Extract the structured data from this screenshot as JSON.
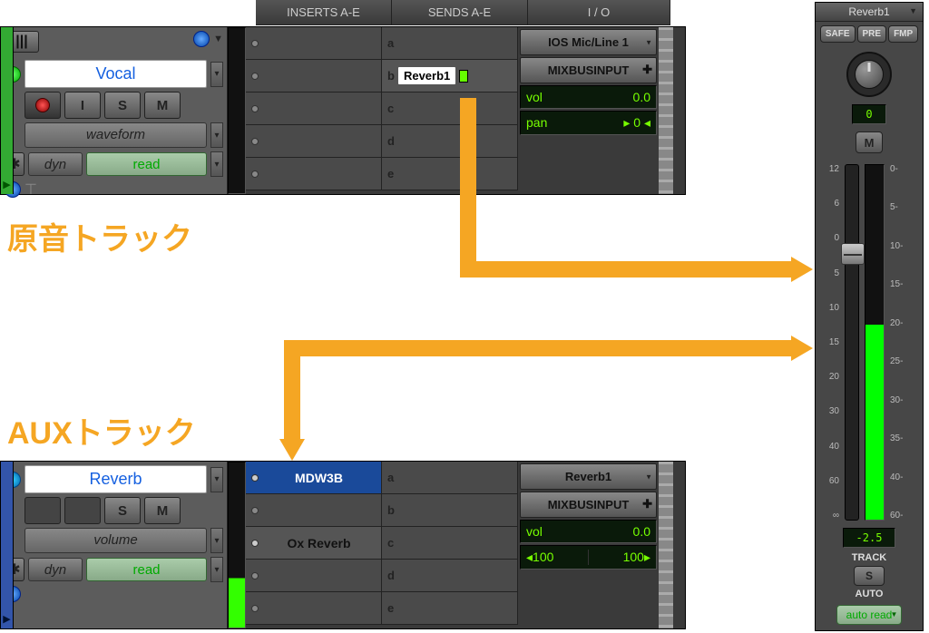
{
  "annotations": {
    "source_track": "原音トラック",
    "aux_track": "AUXトラック"
  },
  "headers": {
    "inserts": "INSERTS A-E",
    "sends": "SENDS A-E",
    "io": "I / O"
  },
  "track1": {
    "name": "Vocal",
    "view": "waveform",
    "dyn": "dyn",
    "auto": "read",
    "buttons": {
      "i": "I",
      "s": "S",
      "m": "M"
    },
    "sends": {
      "a": "a",
      "b": "b",
      "c": "c",
      "d": "d",
      "e": "e",
      "b_assign": "Reverb1"
    },
    "io": {
      "input": "IOS Mic/Line 1",
      "output": "MIXBUSINPUT",
      "vol_label": "vol",
      "vol_val": "0.0",
      "pan_label": "pan",
      "pan_val": "▸  0 ◂"
    }
  },
  "track2": {
    "name": "Reverb",
    "view": "volume",
    "dyn": "dyn",
    "auto": "read",
    "buttons": {
      "s": "S",
      "m": "M"
    },
    "inserts": {
      "a": "MDW3B",
      "c": "Ox Reverb"
    },
    "sends": {
      "a": "a",
      "b": "b",
      "c": "c",
      "d": "d",
      "e": "e"
    },
    "io": {
      "input": "Reverb1",
      "output": "MIXBUSINPUT",
      "vol_label": "vol",
      "vol_val": "0.0",
      "pan_l": "◂100",
      "pan_r": "100▸"
    }
  },
  "send_window": {
    "title": "Reverb1",
    "pills": {
      "safe": "SAFE",
      "pre": "PRE",
      "fmp": "FMP"
    },
    "pan_value": "0",
    "mute": "M",
    "fader_scale": [
      "12",
      "6",
      "0",
      "5",
      "10",
      "15",
      "20",
      "30",
      "40",
      "60",
      "∞"
    ],
    "meter_scale": [
      "0-",
      "5-",
      "10-",
      "15-",
      "20-",
      "25-",
      "30-",
      "35-",
      "40-",
      "60-"
    ],
    "level": "-2.5",
    "track_label": "TRACK",
    "solo": "S",
    "auto_label": "AUTO",
    "auto_mode": "auto read"
  },
  "top_left": {
    "track_height_icon": "|||",
    "clock_icon": "●"
  }
}
